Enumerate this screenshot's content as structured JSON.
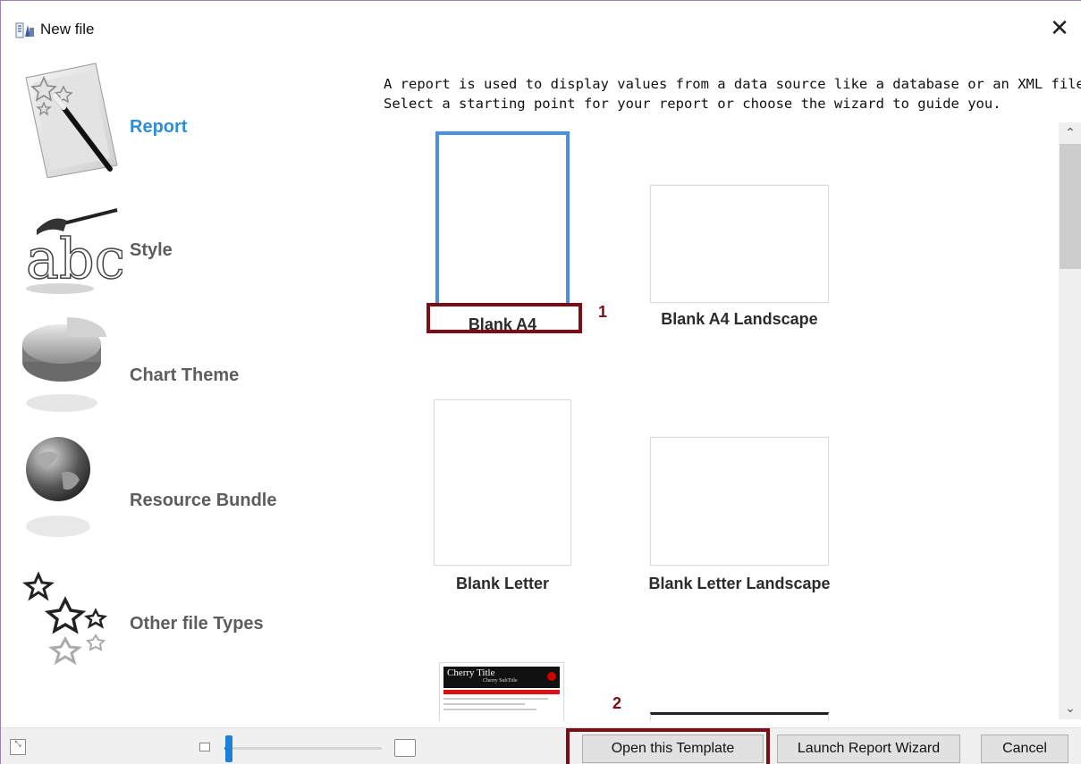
{
  "window": {
    "title": "New file"
  },
  "nav": {
    "items": [
      {
        "label": "Report",
        "icon": "report-wand-icon",
        "active": true
      },
      {
        "label": "Style",
        "icon": "style-abc-brush-icon",
        "active": false
      },
      {
        "label": "Chart Theme",
        "icon": "pie-chart-icon",
        "active": false
      },
      {
        "label": "Resource Bundle",
        "icon": "globe-icon",
        "active": false
      },
      {
        "label": "Other file Types",
        "icon": "stars-icon",
        "active": false
      }
    ]
  },
  "description": {
    "line1": "A report is used to display values from a data source like a database or an XML file.",
    "line2": "Select a starting point for your report or choose the wizard to guide you."
  },
  "templates": [
    {
      "label": "Blank A4",
      "selected": true
    },
    {
      "label": "Blank A4 Landscape",
      "selected": false
    },
    {
      "label": "Blank Letter",
      "selected": false
    },
    {
      "label": "Blank Letter Landscape",
      "selected": false
    },
    {
      "label": "",
      "preview_title": "Cherry Title",
      "preview_subtitle": "Cherry SubTitle"
    },
    {
      "label": ""
    }
  ],
  "annotations": {
    "one": "1",
    "two": "2",
    "color": "#7a0d16"
  },
  "buttons": {
    "open_template": "Open this Template",
    "launch_wizard": "Launch Report Wizard",
    "cancel": "Cancel"
  },
  "zoom": {
    "level": 0.02
  },
  "colors": {
    "accent": "#2c8fd6",
    "selection": "#4a8fe0",
    "slider": "#1f7fd8"
  }
}
